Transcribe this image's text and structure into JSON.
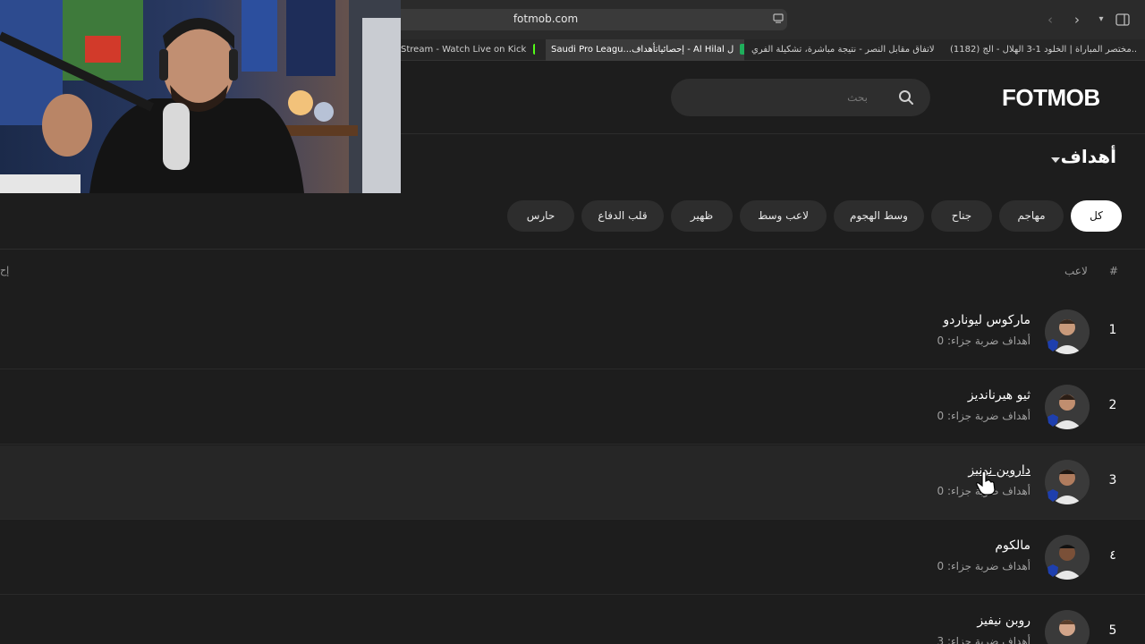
{
  "browser": {
    "url": "fotmob.com",
    "tabs": [
      {
        "label": "Stream - Watch Live on Kick",
        "active": false,
        "fav": "#53fc18"
      },
      {
        "label": "Saudi Pro Leagu...إحصائياتأهداف - Al Hilal ل",
        "active": true,
        "fav": "#1fae5b"
      },
      {
        "label": "الاتفاق مقابل النصر - نتيجة مباشرة، تشكيلة الفري...",
        "active": false,
        "fav": "#1fae5b"
      },
      {
        "label": "(1182) مختصر المباراة | الخلود 1-3 الهلال - الج...",
        "active": false,
        "fav": "#ff0000"
      }
    ]
  },
  "header": {
    "logo": "FOTMOB",
    "search_placeholder": "بحث"
  },
  "section": {
    "title": "أهداف"
  },
  "filters": [
    "كل",
    "مهاجم",
    "جناح",
    "وسط الهجوم",
    "لاعب وسط",
    "ظهير",
    "قلب الدفاع",
    "حارس"
  ],
  "table": {
    "col_rank": "#",
    "col_player": "لاعب",
    "col_right": "إح",
    "rows": [
      {
        "rank": "1",
        "name": "ماركوس ليوناردو",
        "sub": "أهداف ضربة جزاء: 0"
      },
      {
        "rank": "2",
        "name": "ثيو هيرنانديز",
        "sub": "أهداف ضربة جزاء: 0"
      },
      {
        "rank": "3",
        "name": "داروين نونيز",
        "sub": "أهداف ضربة جزاء: 0"
      },
      {
        "rank": "٤",
        "name": "مالكوم",
        "sub": "أهداف ضربة جزاء: 0"
      },
      {
        "rank": "5",
        "name": "روبن نيفيز",
        "sub": "أهداف ضربة جزاء: 3"
      }
    ]
  },
  "colors": {
    "accent": "#ffffff",
    "bg": "#1d1d1d",
    "chip": "#2d2d2d",
    "badge": "#1e3fae"
  }
}
